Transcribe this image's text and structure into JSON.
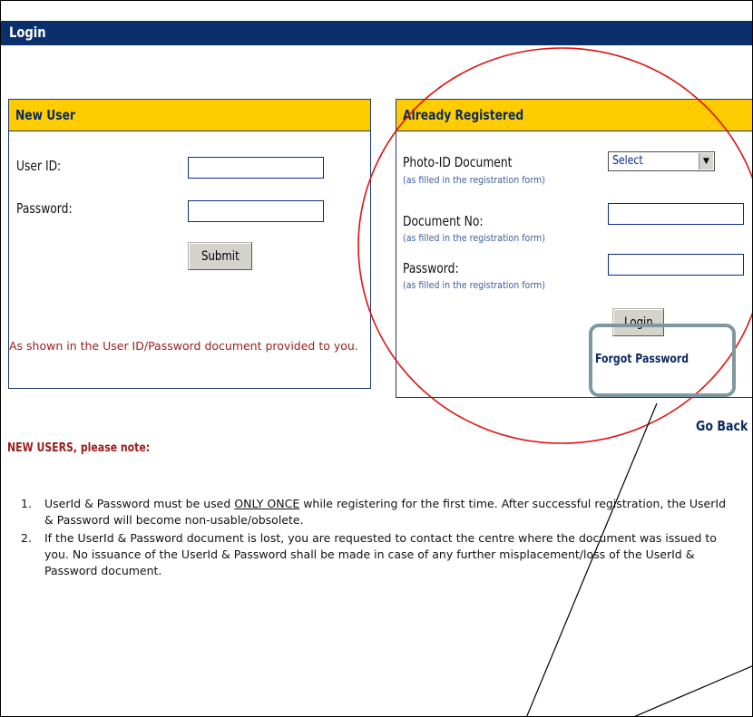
{
  "header": {
    "title": "Login"
  },
  "new_user": {
    "heading": "New User",
    "user_id_label": "User ID:",
    "password_label": "Password:",
    "user_id_value": "",
    "password_value": "",
    "submit_label": "Submit",
    "message": "As shown in the User ID/Password document provided to you."
  },
  "registered": {
    "heading": "Already Registered",
    "photo_id_label": "Photo-ID Document",
    "photo_id_hint": "(as filled in the registration form)",
    "photo_id_selected": "Select",
    "doc_no_label": "Document No:",
    "doc_no_hint": "(as filled in the registration form)",
    "doc_no_value": "",
    "password_label": "Password:",
    "password_hint": "(as filled in the registration form)",
    "password_value": "",
    "login_label": "Login",
    "forgot_label": "Forgot Password"
  },
  "go_back_label": "Go Back",
  "notes": {
    "heading": "NEW USERS, please note:",
    "items": [
      {
        "num": "1.",
        "pre": "UserId & Password must be used ",
        "emph": "ONLY ONCE",
        "post": " while registering for the first time. After successful registration, the UserId & Password will become non-usable/obsolete."
      },
      {
        "num": "2.",
        "text": "If the UserId & Password document is lost, you are requested to contact the centre where the document was issued to you. No issuance of the UserId & Password shall be made in case of any further misplacement/loss of the UserId & Password  document."
      }
    ]
  },
  "colors": {
    "title_bar": "#0a2f6b",
    "panel_header": "#ffcc00",
    "annotation_circle": "#e01010",
    "annotation_box": "#7f98a0",
    "note_heading": "#9a1c1c"
  }
}
